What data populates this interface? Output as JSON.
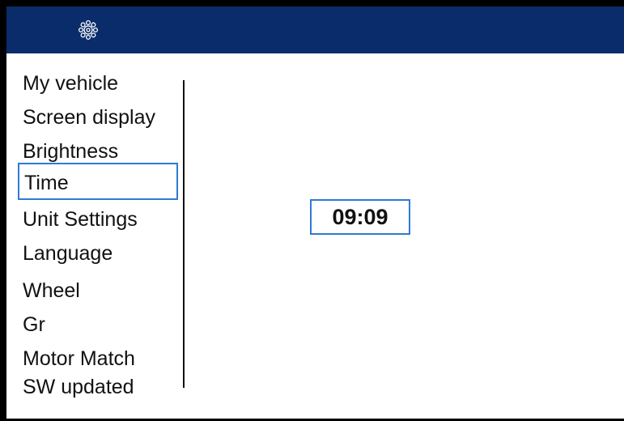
{
  "header": {
    "icon": "gear-icon",
    "background_color": "#0b2c6b"
  },
  "menu": {
    "items": [
      {
        "label": "My vehicle"
      },
      {
        "label": "Screen display"
      },
      {
        "label": "Brightness"
      },
      {
        "label": "Time",
        "selected": true
      },
      {
        "label": "Unit Settings"
      },
      {
        "label": "Language"
      },
      {
        "label": "Wheel"
      },
      {
        "label": "Gr"
      },
      {
        "label": "Motor Match"
      },
      {
        "label": "SW updated"
      }
    ],
    "selection_color": "#2f7ad6"
  },
  "main": {
    "time_value": "09:09"
  }
}
